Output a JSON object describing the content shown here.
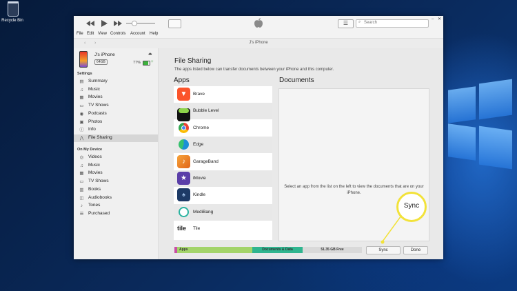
{
  "desktop": {
    "recycle_bin_label": "Recycle Bin"
  },
  "window": {
    "menu": [
      "File",
      "Edit",
      "View",
      "Controls",
      "Account",
      "Help"
    ],
    "search_placeholder": "Search",
    "device_title": "J's iPhone"
  },
  "device": {
    "name": "J's iPhone",
    "capacity": "64GB",
    "battery": "77%"
  },
  "sidebar": {
    "settings_header": "Settings",
    "settings_items": [
      {
        "label": "Summary",
        "icon": "summary-icon"
      },
      {
        "label": "Music",
        "icon": "music-icon"
      },
      {
        "label": "Movies",
        "icon": "movies-icon"
      },
      {
        "label": "TV Shows",
        "icon": "tv-icon"
      },
      {
        "label": "Podcasts",
        "icon": "podcasts-icon"
      },
      {
        "label": "Photos",
        "icon": "photos-icon"
      },
      {
        "label": "Info",
        "icon": "info-icon"
      },
      {
        "label": "File Sharing",
        "icon": "file-sharing-icon"
      }
    ],
    "on_device_header": "On My Device",
    "device_items": [
      {
        "label": "Videos",
        "icon": "videos-icon"
      },
      {
        "label": "Music",
        "icon": "music-icon"
      },
      {
        "label": "Movies",
        "icon": "movies-icon"
      },
      {
        "label": "TV Shows",
        "icon": "tv-icon"
      },
      {
        "label": "Books",
        "icon": "books-icon"
      },
      {
        "label": "Audiobooks",
        "icon": "audiobooks-icon"
      },
      {
        "label": "Tones",
        "icon": "tones-icon"
      },
      {
        "label": "Purchased",
        "icon": "purchased-icon"
      }
    ]
  },
  "main": {
    "title": "File Sharing",
    "subtitle": "The apps listed below can transfer documents between your iPhone and this computer.",
    "apps_header": "Apps",
    "documents_header": "Documents",
    "documents_placeholder": "Select an app from the list on the left to view the documents that are on your iPhone.",
    "apps": [
      {
        "name": "Brave",
        "color": "#fb542b"
      },
      {
        "name": "Bubble Level",
        "color": "#2f7d1a"
      },
      {
        "name": "Chrome",
        "color": "#ffffff"
      },
      {
        "name": "Edge",
        "color": "#1b8fd6"
      },
      {
        "name": "GarageBand",
        "color": "#f28a1f"
      },
      {
        "name": "iMovie",
        "color": "#5a3ea8"
      },
      {
        "name": "Kindle",
        "color": "#1d3a66"
      },
      {
        "name": "MediBang",
        "color": "#ffffff"
      },
      {
        "name": "Tile",
        "color": "#ffffff"
      }
    ]
  },
  "storage": {
    "segments": [
      {
        "label": "Apps",
        "color": "#a3d46a"
      },
      {
        "label": "Documents & Data",
        "color": "#2fb58f"
      },
      {
        "label": "51.35 GB Free",
        "color": "#d9d9d9"
      }
    ]
  },
  "buttons": {
    "sync": "Sync",
    "done": "Done"
  },
  "callout": {
    "label": "Sync",
    "color": "#f2e23a"
  }
}
